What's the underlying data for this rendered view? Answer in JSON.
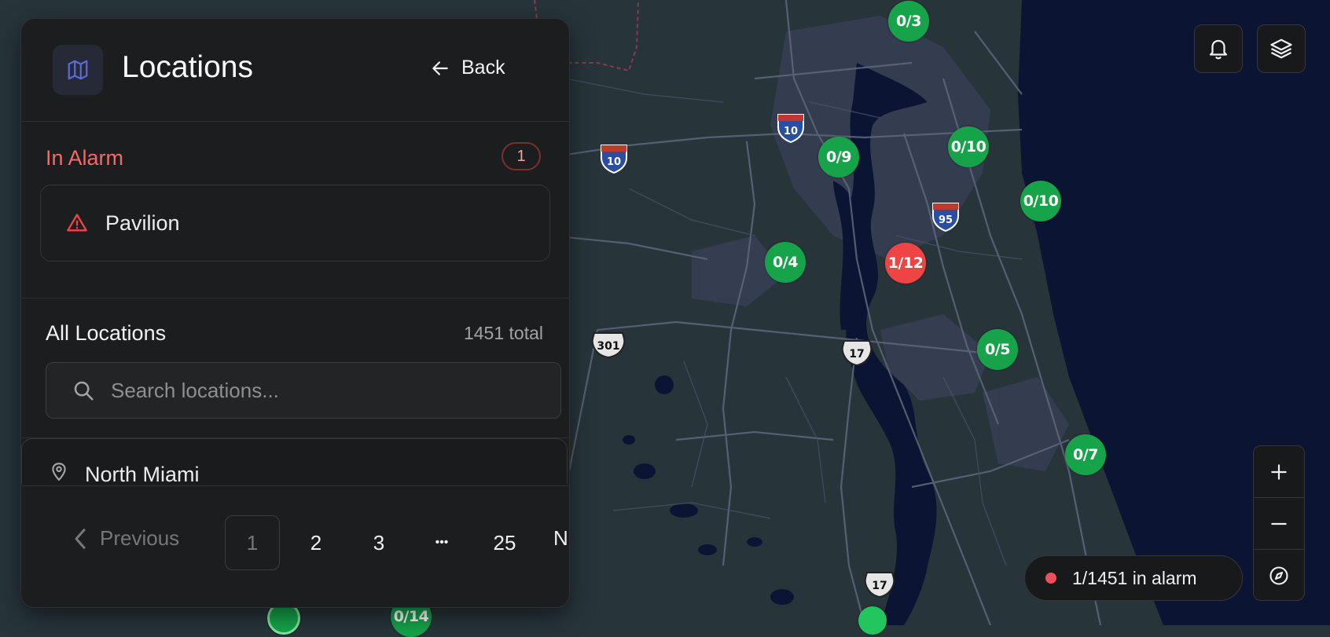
{
  "panel": {
    "title": "Locations",
    "back_label": "Back",
    "in_alarm": {
      "title": "In Alarm",
      "count": "1",
      "items": [
        {
          "label": "Pavilion"
        }
      ]
    },
    "all_locations": {
      "title": "All Locations",
      "total": "1451 total",
      "search_placeholder": "Search locations...",
      "items": [
        {
          "label": "North Miami"
        }
      ]
    },
    "pagination": {
      "previous_label": "Previous",
      "pages": [
        "1",
        "2",
        "3",
        "•••",
        "25"
      ],
      "active_page": "1",
      "next_label": "N"
    }
  },
  "map": {
    "markers": [
      {
        "label": "0/3",
        "status": "ok"
      },
      {
        "label": "0/9",
        "status": "ok"
      },
      {
        "label": "0/10",
        "status": "ok"
      },
      {
        "label": "0/10",
        "status": "ok"
      },
      {
        "label": "0/4",
        "status": "ok"
      },
      {
        "label": "1/12",
        "status": "alarm"
      },
      {
        "label": "0/5",
        "status": "ok"
      },
      {
        "label": "0/7",
        "status": "ok"
      },
      {
        "label": "0/14",
        "status": "ok"
      }
    ],
    "highway_shields": [
      {
        "label": "10",
        "type": "interstate"
      },
      {
        "label": "10",
        "type": "interstate"
      },
      {
        "label": "95",
        "type": "interstate"
      },
      {
        "label": "301",
        "type": "us"
      },
      {
        "label": "17",
        "type": "us"
      },
      {
        "label": "17",
        "type": "us"
      }
    ]
  },
  "status": {
    "alarm_summary": "1/1451 in alarm"
  },
  "colors": {
    "ok_marker": "#16a34a",
    "alarm_marker": "#ef4444",
    "alarm_text": "#f26a6a",
    "water": "#0b1433",
    "land": "#27353a"
  }
}
